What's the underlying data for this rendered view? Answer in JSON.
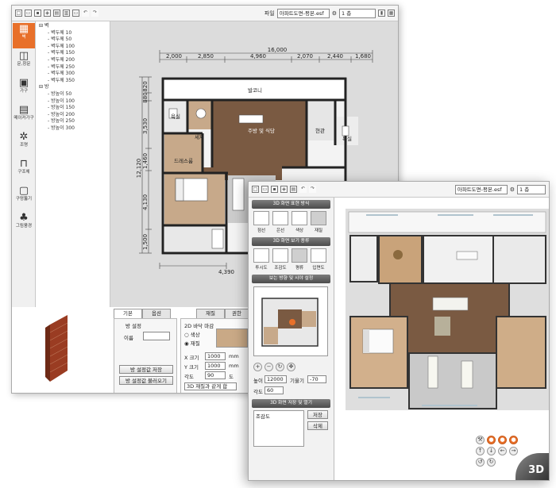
{
  "main": {
    "toolbar": {
      "file_label": "파일",
      "file_value": "아파트도면-평본.esf",
      "floor_value": "1 층"
    },
    "iconbar": [
      {
        "label": "벽",
        "glyph": "▦"
      },
      {
        "label": "문,창문",
        "glyph": "◫"
      },
      {
        "label": "가구",
        "glyph": "▣"
      },
      {
        "label": "메이커가구",
        "glyph": "▤"
      },
      {
        "label": "조명",
        "glyph": "✲"
      },
      {
        "label": "구조체",
        "glyph": "⊓"
      },
      {
        "label": "구멍뚫기",
        "glyph": "▢"
      },
      {
        "label": "그림풍경",
        "glyph": "♣"
      }
    ],
    "tree": {
      "group1": "벽",
      "group1_items": [
        "벽두께 10",
        "벽두께 50",
        "벽두께 100",
        "벽두께 150",
        "벽두께 200",
        "벽두께 250",
        "벽두께 300",
        "벽두께 350"
      ],
      "group2": "방",
      "group2_items": [
        "방높이 50",
        "방높이 100",
        "방높이 150",
        "방높이 200",
        "방높이 250",
        "방높이 300"
      ]
    },
    "plan": {
      "total_width": "16,000",
      "top_dims": [
        "2,000",
        "2,850",
        "4,960",
        "2,070",
        "2,440",
        "1,680"
      ],
      "left_total": "12,120",
      "left_dims": [
        "820",
        "880",
        "3,530",
        "1,460",
        "4,130",
        "1,500"
      ],
      "bottom_dim": "4,390",
      "rooms": [
        "발코니",
        "욕실",
        "세제",
        "주방 및 식당",
        "현관",
        "욕실",
        "드레스룸"
      ]
    },
    "bottom_tabs": [
      "기본",
      "옵션",
      "재질",
      "권한"
    ],
    "room_settings": {
      "title": "방 설정",
      "name_label": "이름",
      "save_button": "방 설정값 저장",
      "load_button": "방 설정값 불러오기"
    },
    "floor_finish": {
      "title": "2D 바닥 마감",
      "color_option": "색상",
      "material_option": "재질",
      "x_label": "X 크기",
      "x_value": "1000",
      "y_label": "Y 크기",
      "y_value": "1000",
      "angle_label": "각도",
      "angle_value": "90",
      "unit_mm": "mm",
      "unit_deg": "도",
      "select_value": "3D 재질과 같게 합"
    }
  },
  "viewer": {
    "toolbar": {
      "file_value": "아파트도면-평본.esf",
      "floor_value": "1 층"
    },
    "section_expression": "3D 화면 표현 방식",
    "expression_modes": [
      "점선",
      "은선",
      "색상",
      "재질"
    ],
    "section_view": "3D 화면 보기 종류",
    "view_modes": [
      "투시도",
      "조감도",
      "평류",
      "입면도"
    ],
    "section_direction": "보는 방향 및 시야 설정",
    "height_label": "높이",
    "height_value": "12000",
    "tilt_label": "기울기",
    "tilt_value": "-70",
    "angle_label": "각도",
    "angle_value": "60",
    "section_save": "3D 화면 저장 및 열기",
    "list_item": "조감도",
    "save_button": "저장",
    "delete_button": "삭제",
    "badge": "3D"
  },
  "colors": {
    "accent": "#e8702a",
    "wood": "#7a5a42",
    "wall": "#2a2a2a",
    "canvas": "#dcdcdc"
  }
}
